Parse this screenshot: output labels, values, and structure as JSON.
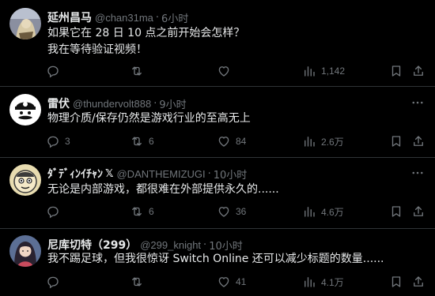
{
  "posts": [
    {
      "name": "延州昌马",
      "handle": "@chan31ma",
      "sep": "·",
      "time": "6小时",
      "lines": [
        "如果它在 28 日 10 点之前开始会怎样？",
        "我在等待验证视频！"
      ],
      "replies": "",
      "reposts": "",
      "likes": "",
      "views": "1,142"
    },
    {
      "name": "雷伏",
      "handle": "@thundervolt888",
      "sep": "·",
      "time": "9小时",
      "lines": [
        "物理介质/保存仍然是游戏行业的至高无上"
      ],
      "replies": "3",
      "reposts": "6",
      "likes": "84",
      "views": "2.6万"
    },
    {
      "name": "ﾀﾞﾃﾞｨﾝｲﾁｬﾝ",
      "badge": "𝕏",
      "handle": "@DANTHEMIZUGI",
      "sep": "·",
      "time": "10小时",
      "lines": [
        "无论是内部游戏，都很难在外部提供永久的......"
      ],
      "replies": "",
      "reposts": "6",
      "likes": "36",
      "views": "4.6万"
    },
    {
      "name": "尼库切特（299）",
      "handle": "@299_knight",
      "sep": "·",
      "time": "10小时",
      "lines": [
        "我不踢足球，但我很惊讶 Switch Online 还可以减少标题的数量......"
      ],
      "replies": "",
      "reposts": "",
      "likes": "41",
      "views": "4.1万"
    }
  ],
  "colors": {
    "background": "#000000",
    "text": "#e7e9ea",
    "secondary": "#71767b",
    "divider": "#2f3336"
  },
  "icons": [
    "more-icon",
    "reply-icon",
    "repost-icon",
    "like-icon",
    "views-icon",
    "bookmark-icon",
    "share-icon"
  ]
}
